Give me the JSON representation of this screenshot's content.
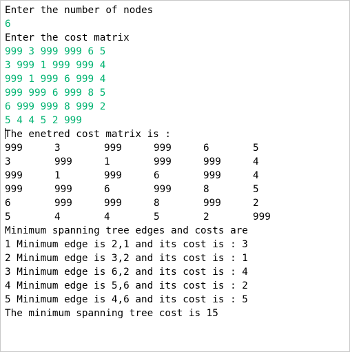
{
  "console": {
    "prompt_nodes": "Enter the number of nodes",
    "input_nodes": "6",
    "prompt_matrix": "Enter the cost matrix",
    "input_rows": [
      "999 3 999 999 6 5",
      "3 999 1 999 999 4",
      "999 1 999 6 999 4",
      "999 999 6 999 8 5",
      "6 999 999 8 999 2",
      "5 4 4 5 2 999"
    ],
    "matrix_header": "The enetred cost matrix is :",
    "matrix": [
      [
        "999",
        "3",
        "999",
        "999",
        "6",
        "5"
      ],
      [
        "3",
        "999",
        "1",
        "999",
        "999",
        "4"
      ],
      [
        "999",
        "1",
        "999",
        "6",
        "999",
        "4"
      ],
      [
        "999",
        "999",
        "6",
        "999",
        "8",
        "5"
      ],
      [
        "6",
        "999",
        "999",
        "8",
        "999",
        "2"
      ],
      [
        "5",
        "4",
        "4",
        "5",
        "2",
        "999"
      ]
    ],
    "mst_header": "Minimum spanning tree edges and costs are",
    "edges": [
      "1 Minimum edge is 2,1 and its cost is : 3",
      "2 Minimum edge is 3,2 and its cost is : 1",
      "3 Minimum edge is 6,2 and its cost is : 4",
      "4 Minimum edge is 5,6 and its cost is : 2",
      "5 Minimum edge is 4,6 and its cost is : 5"
    ],
    "total": "The minimum spanning tree cost is 15",
    "colors": {
      "input": "#00b371",
      "output": "#000000",
      "background": "#ffffff"
    }
  }
}
